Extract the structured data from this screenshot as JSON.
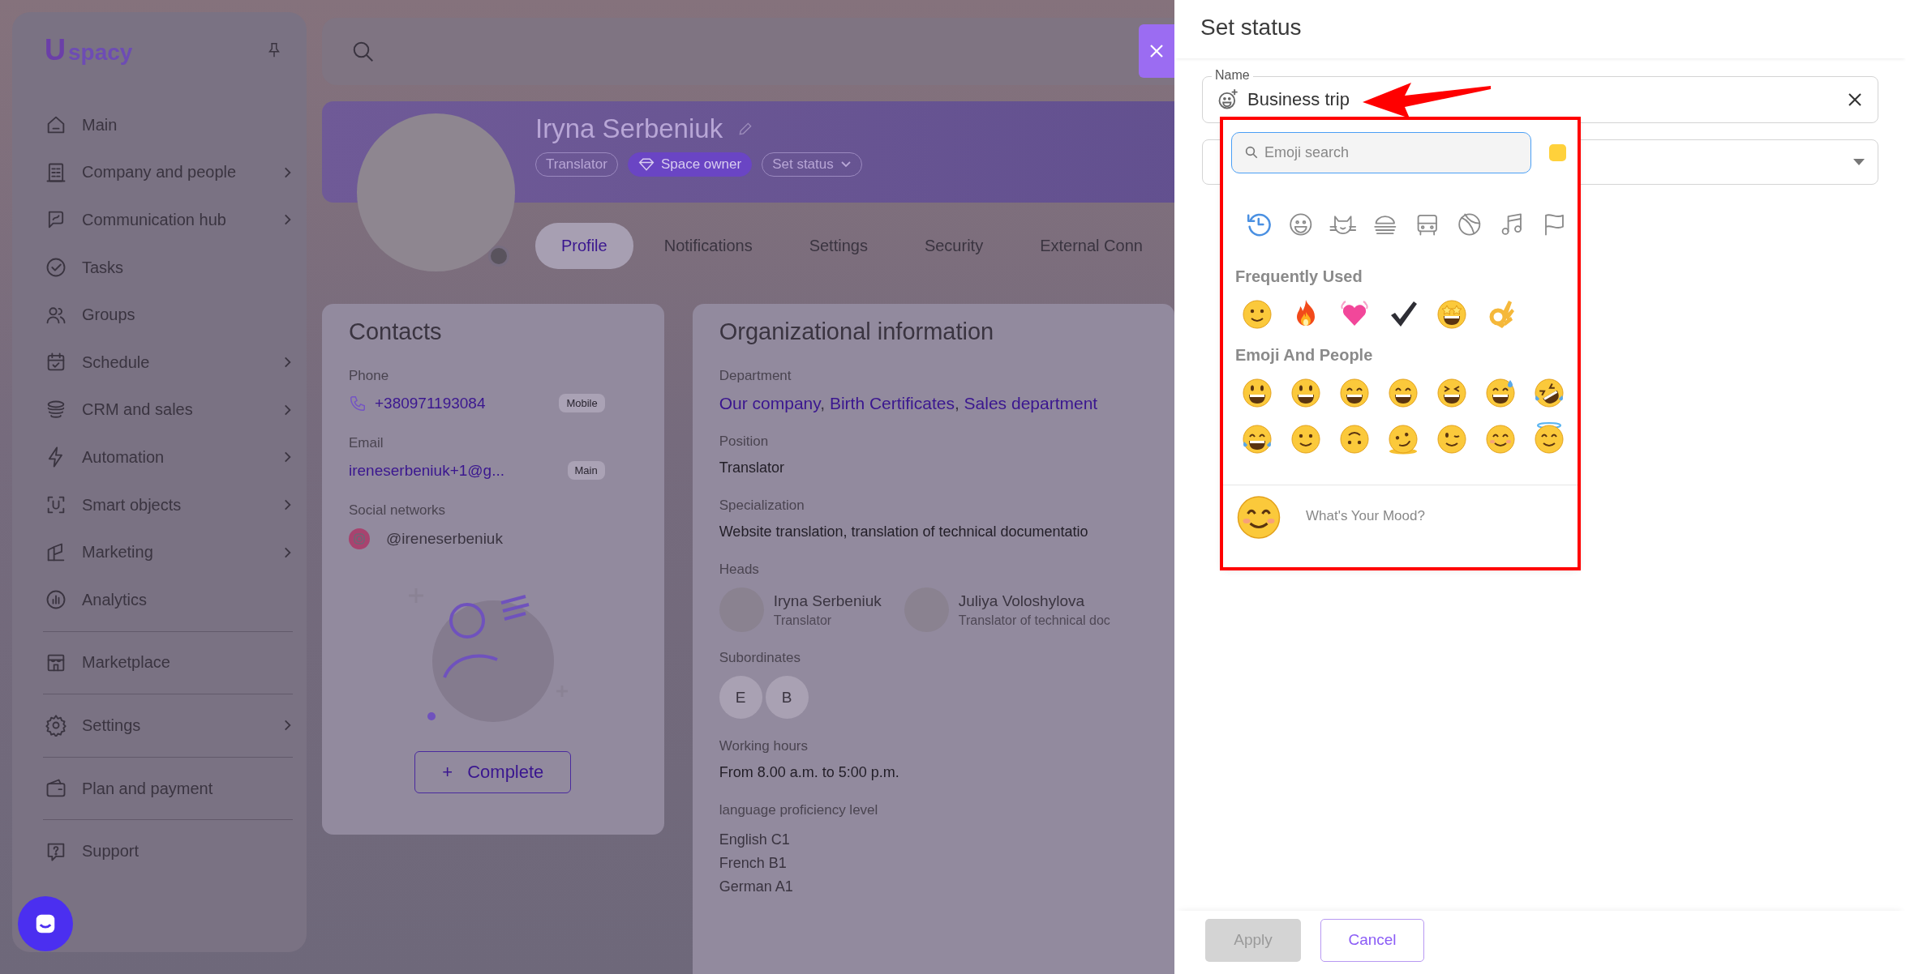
{
  "sidebar": {
    "logo": {
      "mark": "U",
      "name": "spacy"
    },
    "groups": [
      [
        {
          "label": "Main",
          "expandable": false
        },
        {
          "label": "Company and people",
          "expandable": true
        },
        {
          "label": "Communication hub",
          "expandable": true
        },
        {
          "label": "Tasks",
          "expandable": false
        },
        {
          "label": "Groups",
          "expandable": false
        },
        {
          "label": "Schedule",
          "expandable": true
        },
        {
          "label": "CRM and sales",
          "expandable": true
        },
        {
          "label": "Automation",
          "expandable": true
        },
        {
          "label": "Smart objects",
          "expandable": true
        },
        {
          "label": "Marketing",
          "expandable": true
        },
        {
          "label": "Analytics",
          "expandable": false
        }
      ],
      [
        {
          "label": "Marketplace",
          "expandable": false
        }
      ],
      [
        {
          "label": "Settings",
          "expandable": true
        }
      ],
      [
        {
          "label": "Plan and payment",
          "expandable": false
        }
      ],
      [
        {
          "label": "Support",
          "expandable": false
        }
      ]
    ]
  },
  "profile": {
    "name": "Iryna Serbeniuk",
    "badges": [
      {
        "label": "Translator",
        "kind": "tag"
      },
      {
        "label": "Space owner",
        "kind": "owner"
      },
      {
        "label": "Set status",
        "kind": "dropdown"
      }
    ],
    "tabs": [
      {
        "label": "Profile",
        "selected": true
      },
      {
        "label": "Notifications",
        "selected": false
      },
      {
        "label": "Settings",
        "selected": false
      },
      {
        "label": "Security",
        "selected": false
      },
      {
        "label": "External Conn",
        "selected": false
      }
    ]
  },
  "contacts": {
    "title": "Contacts",
    "fields": [
      {
        "kind": "phone",
        "label": "Phone",
        "value": "+380971193084",
        "tag": "Mobile"
      },
      {
        "kind": "email",
        "label": "Email",
        "value": "ireneserbeniuk+1@g...",
        "tag": "Main"
      },
      {
        "kind": "social",
        "label": "Social networks",
        "value": "@ireneserbeniuk"
      }
    ],
    "complete_button": {
      "icon": "+",
      "label": "Complete"
    }
  },
  "org": {
    "title": "Organizational information",
    "department_label": "Department",
    "departments": [
      "Our company",
      "Birth Certificates",
      "Sales department"
    ],
    "separator": ", ",
    "sections": [
      {
        "label": "Position",
        "value": "Translator"
      },
      {
        "label": "Specialization",
        "value": "Website translation, translation of technical documentatio"
      }
    ],
    "heads_label": "Heads",
    "heads": [
      {
        "name": "Iryna Serbeniuk",
        "role": "Translator"
      },
      {
        "name": "Juliya Voloshylova",
        "role": "Translator of technical doc"
      }
    ],
    "subordinates_label": "Subordinates",
    "subordinates": [
      "E",
      "B"
    ],
    "hours_label": "Working hours",
    "hours": "From 8.00 a.m. to 5:00 p.m.",
    "languages_label": "language proficiency level",
    "languages": [
      "English C1",
      "French B1",
      "German A1"
    ]
  },
  "drawer": {
    "title": "Set status",
    "name_field": {
      "label": "Name",
      "value": "Business trip"
    },
    "emoji_picker": {
      "search_placeholder": "Emoji search",
      "categories": [
        {
          "kind": "recent",
          "selected": true
        },
        {
          "kind": "smileys",
          "selected": false
        },
        {
          "kind": "animals",
          "selected": false
        },
        {
          "kind": "food",
          "selected": false
        },
        {
          "kind": "travel",
          "selected": false
        },
        {
          "kind": "activities",
          "selected": false
        },
        {
          "kind": "objects",
          "selected": false
        },
        {
          "kind": "flags",
          "selected": false
        }
      ],
      "sections": [
        {
          "title": "Frequently Used",
          "emojis": [
            {
              "kind": "slight-smile"
            },
            {
              "kind": "fire"
            },
            {
              "kind": "heart"
            },
            {
              "kind": "check"
            },
            {
              "kind": "star-struck"
            },
            {
              "kind": "ok-hand"
            }
          ]
        },
        {
          "title": "Emoji And People",
          "emojis": [
            {
              "kind": "grinning"
            },
            {
              "kind": "smiley"
            },
            {
              "kind": "smile-eyes"
            },
            {
              "kind": "beaming"
            },
            {
              "kind": "squinting"
            },
            {
              "kind": "sweat-smile"
            },
            {
              "kind": "rofl"
            },
            {
              "kind": "tears-of-joy"
            },
            {
              "kind": "slight-smile"
            },
            {
              "kind": "upside-down"
            },
            {
              "kind": "melting"
            },
            {
              "kind": "wink"
            },
            {
              "kind": "blush"
            },
            {
              "kind": "halo"
            }
          ]
        }
      ],
      "preview": {
        "kind": "blush",
        "text": "What's Your Mood?"
      }
    },
    "buttons": [
      {
        "label": "Apply",
        "kind": "primary",
        "disabled": true
      },
      {
        "label": "Cancel",
        "kind": "secondary",
        "disabled": false
      }
    ]
  }
}
